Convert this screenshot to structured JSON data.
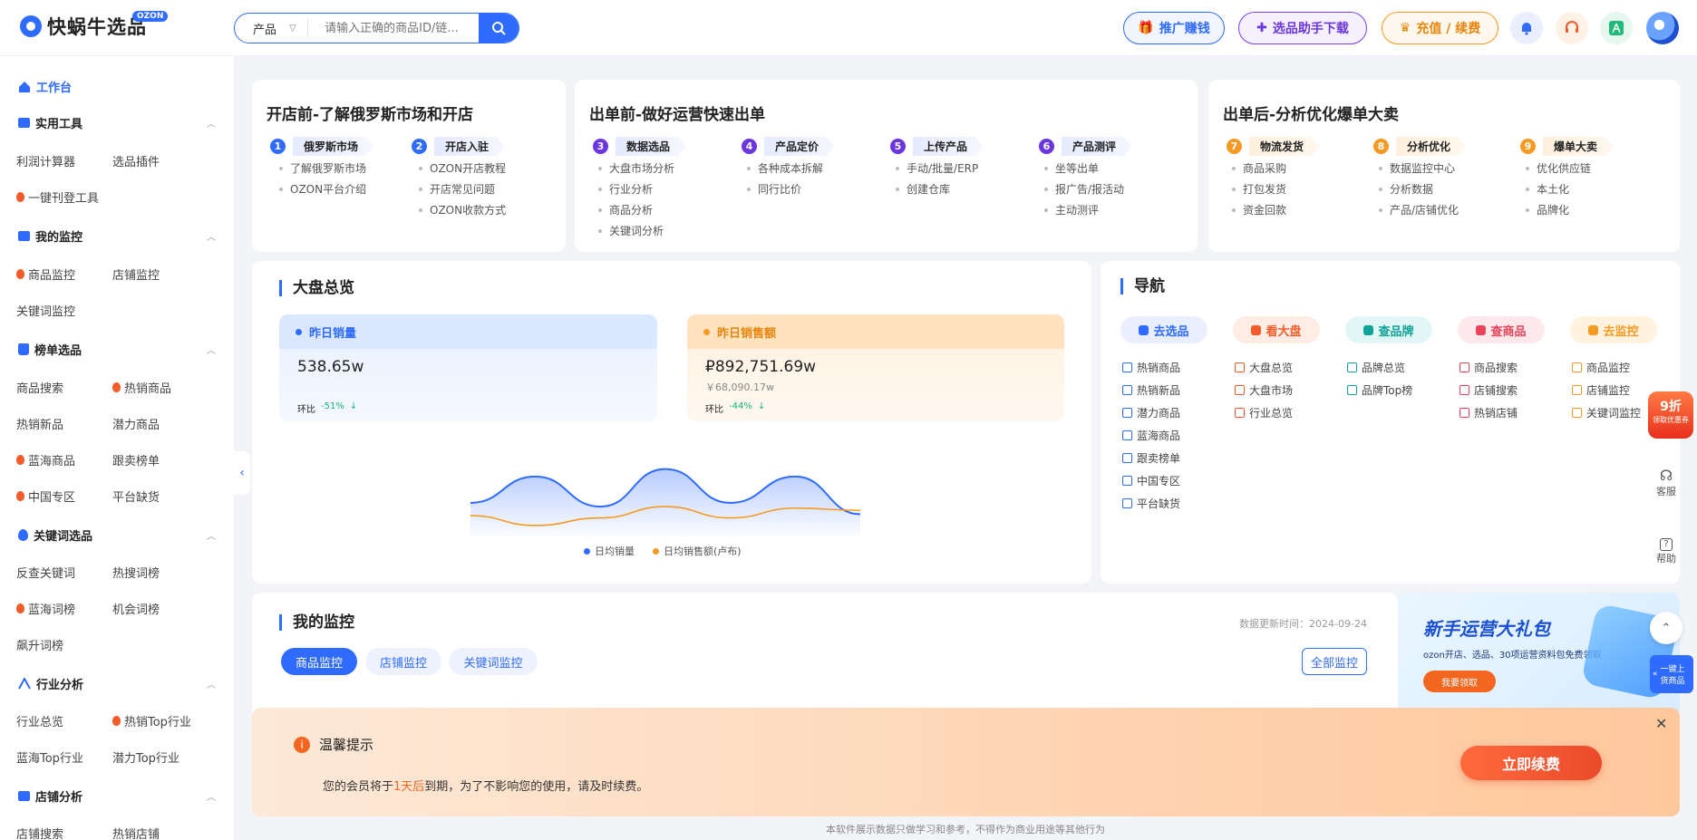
{
  "header": {
    "logo_text": "快蜗牛选品",
    "logo_badge": "OZON",
    "search_select": "产品",
    "search_placeholder": "请输入正确的商品ID/链...",
    "promote_btn": "推广赚钱",
    "plugin_btn": "选品助手下载",
    "recharge_btn": "充值 / 续费"
  },
  "sidebar": {
    "workbench": "工作台",
    "sections": [
      {
        "title": "实用工具",
        "items": [
          "利润计算器",
          "选品插件",
          "一键刊登工具"
        ]
      },
      {
        "title": "我的监控",
        "items": [
          "商品监控",
          "店铺监控",
          "关键词监控"
        ]
      },
      {
        "title": "榜单选品",
        "items": [
          "商品搜索",
          "热销商品",
          "热销新品",
          "潜力商品",
          "蓝海商品",
          "跟卖榜单",
          "中国专区",
          "平台缺货"
        ]
      },
      {
        "title": "关键词选品",
        "items": [
          "反查关键词",
          "热搜词榜",
          "蓝海词榜",
          "机会词榜",
          "飙升词榜"
        ]
      },
      {
        "title": "行业分析",
        "items": [
          "行业总览",
          "热销Top行业",
          "蓝海Top行业",
          "潜力Top行业"
        ]
      },
      {
        "title": "店铺分析",
        "items": [
          "店铺搜索",
          "热销店铺"
        ]
      }
    ]
  },
  "phases": [
    {
      "title": "开店前-了解俄罗斯市场和开店",
      "steps": [
        {
          "num": "1",
          "label": "俄罗斯市场",
          "subs": [
            "了解俄罗斯市场",
            "OZON平台介绍"
          ]
        },
        {
          "num": "2",
          "label": "开店入驻",
          "subs": [
            "OZON开店教程",
            "开店常见问题",
            "OZON收款方式"
          ]
        }
      ]
    },
    {
      "title": "出单前-做好运营快速出单",
      "steps": [
        {
          "num": "3",
          "label": "数据选品",
          "subs": [
            "大盘市场分析",
            "行业分析",
            "商品分析",
            "关键词分析"
          ]
        },
        {
          "num": "4",
          "label": "产品定价",
          "subs": [
            "各种成本拆解",
            "同行比价"
          ]
        },
        {
          "num": "5",
          "label": "上传产品",
          "subs": [
            "手动/批量/ERP",
            "创建仓库"
          ]
        },
        {
          "num": "6",
          "label": "产品测评",
          "subs": [
            "坐等出单",
            "报广告/报活动",
            "主动测评"
          ]
        }
      ]
    },
    {
      "title": "出单后-分析优化爆单大卖",
      "steps": [
        {
          "num": "7",
          "label": "物流发货",
          "subs": [
            "商品采购",
            "打包发货",
            "资金回款"
          ]
        },
        {
          "num": "8",
          "label": "分析优化",
          "subs": [
            "数据监控中心",
            "分析数据",
            "产品/店铺优化"
          ]
        },
        {
          "num": "9",
          "label": "爆单大卖",
          "subs": [
            "优化供应链",
            "本土化",
            "品牌化"
          ]
        }
      ]
    }
  ],
  "overview": {
    "title": "大盘总览",
    "sales": {
      "label": "昨日销量",
      "value": "538.65w",
      "ratio_label": "环比",
      "ratio": "-51%"
    },
    "revenue": {
      "label": "昨日销售额",
      "value": "₽892,751.69w",
      "sub": "￥68,090.17w",
      "ratio_label": "环比",
      "ratio": "-44%"
    },
    "legend_sales": "日均销量",
    "legend_revenue": "日均销售额(卢布)"
  },
  "chart_data": {
    "type": "area",
    "series": [
      {
        "name": "日均销量",
        "values": [
          0.35,
          0.7,
          0.3,
          0.8,
          0.35,
          0.7,
          0.2
        ]
      },
      {
        "name": "日均销售额(卢布)",
        "values": [
          0.18,
          0.05,
          0.15,
          0.3,
          0.15,
          0.28,
          0.25
        ]
      }
    ]
  },
  "nav": {
    "title": "导航",
    "pills": [
      {
        "label": "去选品",
        "color": "#2f6bff",
        "bg": "#e9efff"
      },
      {
        "label": "看大盘",
        "color": "#f25b2a",
        "bg": "#ffece4"
      },
      {
        "label": "查品牌",
        "color": "#11a39a",
        "bg": "#e2f7f5"
      },
      {
        "label": "查商品",
        "color": "#e8445a",
        "bg": "#ffe8ec"
      },
      {
        "label": "去监控",
        "color": "#f59a23",
        "bg": "#fff3e0"
      }
    ],
    "columns": [
      [
        "热销商品",
        "热销新品",
        "潜力商品",
        "蓝海商品",
        "跟卖榜单",
        "中国专区",
        "平台缺货"
      ],
      [
        "大盘总览",
        "大盘市场",
        "行业总览"
      ],
      [
        "品牌总览",
        "品牌Top榜"
      ],
      [
        "商品搜索",
        "店铺搜索",
        "热销店铺"
      ],
      [
        "商品监控",
        "店铺监控",
        "关键词监控"
      ]
    ]
  },
  "monitor": {
    "title": "我的监控",
    "update_time": "数据更新时间：2024-09-24",
    "tabs": [
      "商品监控",
      "店铺监控",
      "关键词监控"
    ],
    "all_btn": "全部监控"
  },
  "promo": {
    "title": "新手运营大礼包",
    "desc": "ozon开店、选品、30项运营资料包免费领取",
    "btn": "我要领取"
  },
  "rail": {
    "discount": "9折",
    "discount_sub": "领取优惠券",
    "service": "客服",
    "help": "帮助",
    "upload": "一键上货商品"
  },
  "alert": {
    "title": "温馨提示",
    "text_pre": "您的会员将于",
    "text_hl": "1天后",
    "text_post": "到期，为了不影响您的使用，请及时续费。",
    "btn": "立即续费"
  },
  "footer": "本软件展示数据只做学习和参考，不得作为商业用途等其他行为"
}
